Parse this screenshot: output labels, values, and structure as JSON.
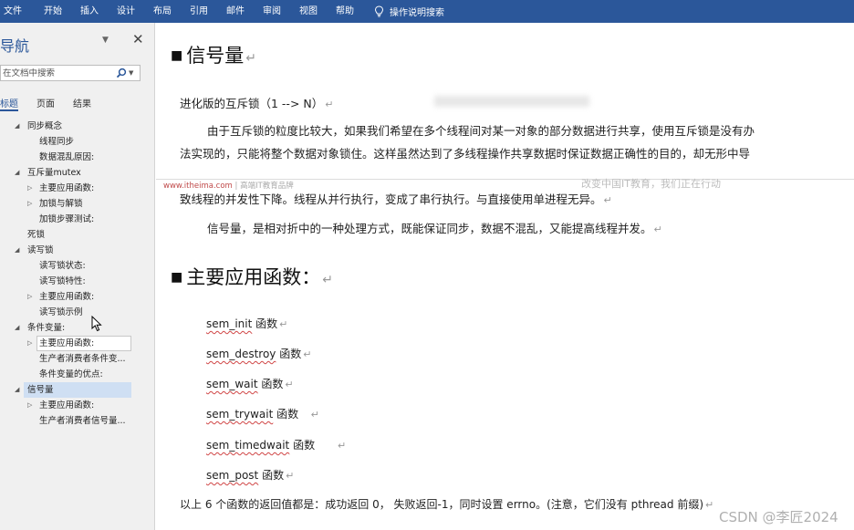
{
  "ribbon": {
    "tabs": [
      "文件",
      "开始",
      "插入",
      "设计",
      "布局",
      "引用",
      "邮件",
      "审阅",
      "视图",
      "帮助"
    ],
    "tell_me": "操作说明搜索",
    "color": "#2b579a"
  },
  "nav": {
    "title": "导航",
    "search_placeholder": "在文档中搜索",
    "tabs": [
      "标题",
      "页面",
      "结果"
    ],
    "active_tab": "标题",
    "tree": [
      {
        "label": "同步概念",
        "level": 1,
        "toggle": "expanded"
      },
      {
        "label": "线程同步",
        "level": 2,
        "toggle": "none"
      },
      {
        "label": "数据混乱原因:",
        "level": 2,
        "toggle": "none"
      },
      {
        "label": "互斥量mutex",
        "level": 1,
        "toggle": "expanded"
      },
      {
        "label": "主要应用函数:",
        "level": 2,
        "toggle": "collapsed"
      },
      {
        "label": "加锁与解锁",
        "level": 2,
        "toggle": "collapsed"
      },
      {
        "label": "加锁步骤测试:",
        "level": 2,
        "toggle": "none"
      },
      {
        "label": "死锁",
        "level": 0,
        "toggle": "none"
      },
      {
        "label": "读写锁",
        "level": 1,
        "toggle": "expanded"
      },
      {
        "label": "读写锁状态:",
        "level": 2,
        "toggle": "none"
      },
      {
        "label": "读写锁特性:",
        "level": 2,
        "toggle": "none"
      },
      {
        "label": "主要应用函数:",
        "level": 2,
        "toggle": "collapsed"
      },
      {
        "label": "读写锁示例",
        "level": 2,
        "toggle": "none"
      },
      {
        "label": "条件变量:",
        "level": 1,
        "toggle": "expanded"
      },
      {
        "label": "主要应用函数:",
        "level": 2,
        "toggle": "collapsed",
        "hovered": true
      },
      {
        "label": "生产者消费者条件变...",
        "level": 2,
        "toggle": "none"
      },
      {
        "label": "条件变量的优点:",
        "level": 2,
        "toggle": "none"
      },
      {
        "label": "信号量",
        "level": 1,
        "toggle": "expanded",
        "selected": true
      },
      {
        "label": "主要应用函数:",
        "level": 2,
        "toggle": "collapsed"
      },
      {
        "label": "生产者消费者信号量...",
        "level": 2,
        "toggle": "none"
      }
    ]
  },
  "doc": {
    "heading1": "信号量",
    "para_intro": "进化版的互斥锁（1 --> N）",
    "para1_line1": "由于互斥锁的粒度比较大，如果我们希望在多个线程间对某一对象的部分数据进行共享，使用互斥锁是没有办",
    "para1_line2": "法实现的，只能将整个数据对象锁住。这样虽然达到了多线程操作共享数据时保证数据正确性的目的，却无形中导",
    "para1_line3": "致线程的并发性下降。线程从并行执行，变成了串行执行。与直接使用单进程无异。",
    "para2": "信号量，是相对折中的一种处理方式，既能保证同步，数据不混乱，又能提高线程并发。",
    "heading2": "主要应用函数：",
    "functions": [
      {
        "name": "sem_init",
        "suffix": "函数"
      },
      {
        "name": "sem_destroy",
        "suffix": "函数"
      },
      {
        "name": "sem_wait",
        "suffix": "函数"
      },
      {
        "name": "sem_trywait",
        "suffix": "函数"
      },
      {
        "name": "sem_timedwait",
        "suffix": "函数"
      },
      {
        "name": "sem_post",
        "suffix": "函数"
      }
    ],
    "summary": "以上 6 个函数的返回值都是：成功返回 0，  失败返回-1，同时设置 errno。(注意，它们没有 pthread 前缀)",
    "para_mark": "↵",
    "watermark_url": "www.itheima.com",
    "watermark_brand": "| 高端IT教育品牌",
    "watermark_slogan": "改变中国IT教育，我们正在行动"
  },
  "overlay": {
    "csdn": "CSDN @李匠2024"
  }
}
